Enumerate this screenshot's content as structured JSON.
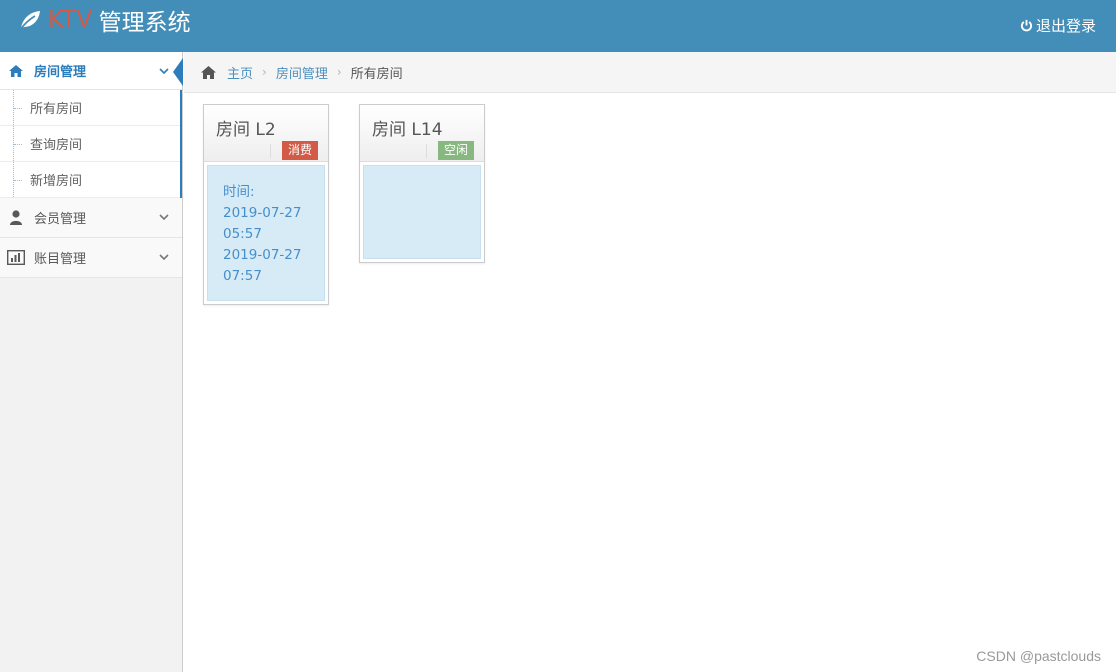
{
  "header": {
    "brand_ktv": "KTV",
    "brand_name": "管理系统",
    "logout_label": "退出登录",
    "bg_color": "#438eb9"
  },
  "sidebar": {
    "items": [
      {
        "label": "房间管理",
        "icon": "home-icon",
        "active": true,
        "submenu": [
          {
            "label": "所有房间"
          },
          {
            "label": "查询房间"
          },
          {
            "label": "新增房间"
          }
        ]
      },
      {
        "label": "会员管理",
        "icon": "user-icon"
      },
      {
        "label": "账目管理",
        "icon": "bar-chart-icon"
      }
    ]
  },
  "breadcrumb": {
    "home": "主页",
    "section": "房间管理",
    "current": "所有房间"
  },
  "rooms": [
    {
      "title": "房间 L2",
      "status": "消费",
      "status_color": "#d15b47",
      "time_label": "时间:",
      "start_date": "2019-07-27",
      "start_time": "05:57",
      "end_date": "2019-07-27",
      "end_time": "07:57"
    },
    {
      "title": "房间 L14",
      "status": "空闲",
      "status_color": "#87b87f"
    }
  ],
  "watermark": "CSDN @pastclouds"
}
